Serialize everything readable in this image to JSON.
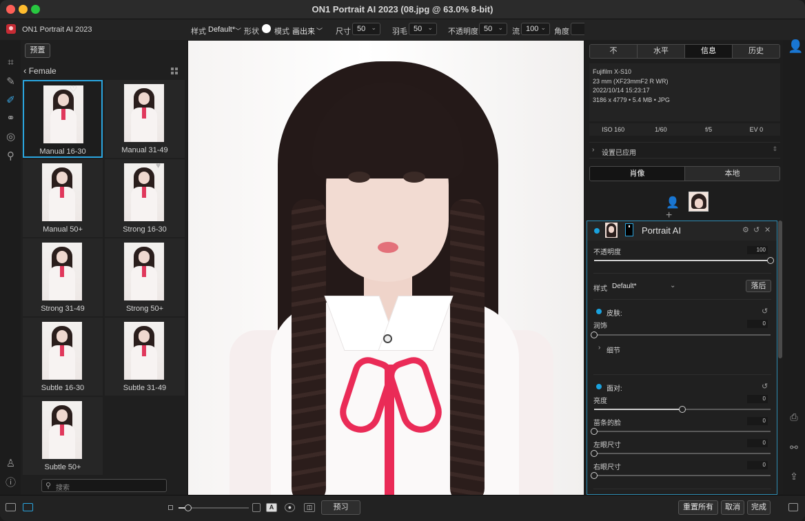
{
  "window": {
    "title": "ON1 Portrait AI 2023 (08.jpg @ 63.0% 8-bit)"
  },
  "toolbar": {
    "app_name": "ON1 Portrait AI 2023",
    "style_label": "样式",
    "style_value": "Default*",
    "shape_label": "形状",
    "mode_label": "模式",
    "mode_value": "画出来",
    "size_label": "尺寸",
    "size_value": "50",
    "feather_label": "羽毛",
    "feather_value": "50",
    "opacity_label": "不透明度",
    "opacity_value": "50",
    "flow_label": "流",
    "flow_value": "100",
    "angle_label": "角度"
  },
  "presets": {
    "button": "预置",
    "category": "Female",
    "items": [
      {
        "label": "Manual 16-30",
        "selected": true,
        "heart": true
      },
      {
        "label": "Manual 31-49"
      },
      {
        "label": "Manual 50+"
      },
      {
        "label": "Strong 16-30",
        "heart": true
      },
      {
        "label": "Strong 31-49"
      },
      {
        "label": "Strong 50+"
      },
      {
        "label": "Subtle 16-30"
      },
      {
        "label": "Subtle 31-49"
      },
      {
        "label": "Subtle 50+"
      }
    ],
    "search_placeholder": "搜索"
  },
  "info_panel": {
    "tabs": [
      "不",
      "水平",
      "信息",
      "历史"
    ],
    "active_tab": "信息",
    "camera": "Fujifilm X-S10",
    "lens": "23 mm (XF23mmF2 R WR)",
    "datetime": "2022/10/14  15:23:17",
    "file_info": "3186 x 4779  •  5.4 MB  •  JPG",
    "exif": [
      "ISO 160",
      "1/60",
      "f/5",
      "EV 0"
    ],
    "settings_applied": "设置已应用"
  },
  "mode_tabs": [
    "肖像",
    "本地"
  ],
  "active_mode": "肖像",
  "module": {
    "title": "Portrait AI",
    "opacity_label": "不透明度",
    "opacity_value": "100",
    "opacity_level": 1.0,
    "style_label": "样式",
    "style_value": "Default*",
    "behind_button": "落后",
    "skin_title": "皮肤:",
    "smooth_label": "润饰",
    "smooth_value": "0",
    "detail_label": "细节",
    "face_title": "面对:",
    "sliders": [
      {
        "label": "亮度",
        "value": "0",
        "level": 0.5
      },
      {
        "label": "苗条的脸",
        "value": "0",
        "level": 0
      },
      {
        "label": "左眼尺寸",
        "value": "0",
        "level": 0
      },
      {
        "label": "右眼尺寸",
        "value": "0",
        "level": 0
      }
    ]
  },
  "bottom": {
    "preview": "预习",
    "reset_all": "重置所有",
    "cancel": "取消",
    "done": "完成"
  },
  "colors": {
    "accent": "#2aa6e0",
    "ribbon": "#ea2b57",
    "logo": "#c62b34"
  }
}
